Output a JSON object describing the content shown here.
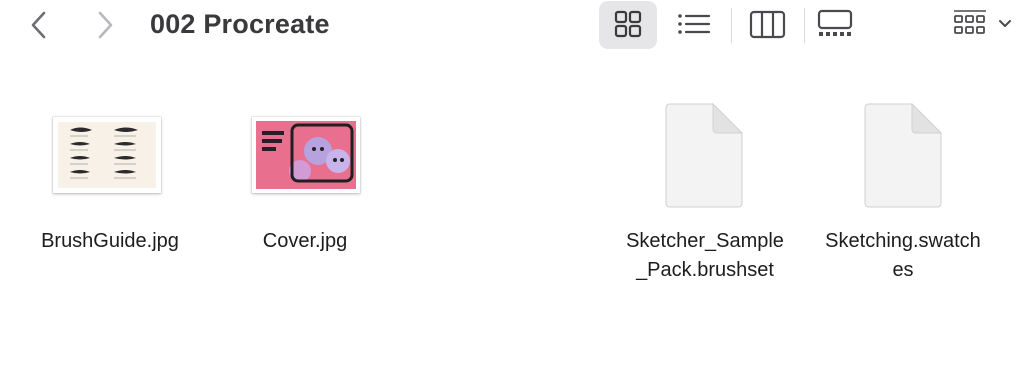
{
  "toolbar": {
    "title": "002 Procreate",
    "back_icon": "chevron-left-icon",
    "forward_icon": "chevron-right-icon",
    "views": [
      "icon-view",
      "list-view",
      "column-view",
      "gallery-view"
    ],
    "active_view": "icon-view",
    "group_icon": "grid-grouping-icon"
  },
  "files": [
    {
      "name": "BrushGuide.jpg",
      "kind": "image"
    },
    {
      "name": "Cover.jpg",
      "kind": "image"
    },
    {
      "name": "Sketcher_Sample\n_Pack.brushset",
      "kind": "document"
    },
    {
      "name": "Sketching.swatch\nes",
      "kind": "document"
    }
  ],
  "colors": {
    "active_view_bg": "#e6e6e8",
    "cover_pink": "#e96f8f",
    "cover_purple": "#b7a2df"
  }
}
